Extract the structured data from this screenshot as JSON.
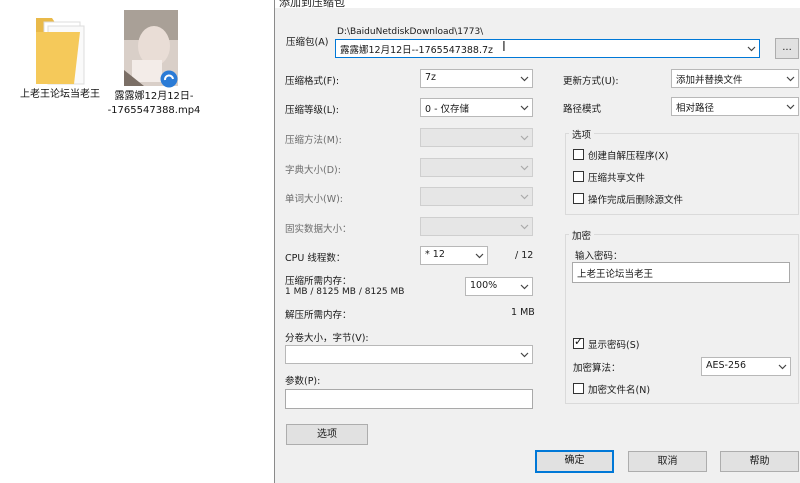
{
  "desktop": {
    "folder": {
      "label": "上老王论坛当老王"
    },
    "video": {
      "label": "露露娜12月12日--1765547388.mp4"
    }
  },
  "dialog": {
    "title": "添加到压缩包",
    "archive": {
      "label": "压缩包(A)",
      "path": "D:\\BaiduNetdiskDownload\\1773\\",
      "filename": "露露娜12月12日--1765547388.7z",
      "browse_label": "..."
    },
    "left": {
      "format": {
        "label": "压缩格式(F):",
        "value": "7z"
      },
      "level": {
        "label": "压缩等级(L):",
        "value": "0 - 仅存储"
      },
      "method": {
        "label": "压缩方法(M):",
        "value": ""
      },
      "dict": {
        "label": "字典大小(D):",
        "value": ""
      },
      "word": {
        "label": "单词大小(W):",
        "value": ""
      },
      "solid": {
        "label": "固实数据大小：",
        "value": ""
      },
      "threads": {
        "label": "CPU 线程数：",
        "value": "* 12",
        "total": "/ 12"
      },
      "memory": {
        "label": "压缩所需内存：",
        "detail": "1 MB / 8125 MB / 8125 MB",
        "percent": "100%"
      },
      "decompress": {
        "label": "解压所需内存：",
        "value": "1 MB"
      },
      "volume": {
        "label": "分卷大小，字节(V):",
        "value": ""
      },
      "params": {
        "label": "参数(P):",
        "value": ""
      },
      "options_button": "选项"
    },
    "right": {
      "update": {
        "label": "更新方式(U):",
        "value": "添加并替换文件"
      },
      "pathmode": {
        "label": "路径模式",
        "value": "相对路径"
      },
      "options_group": {
        "title": "选项",
        "sfx": {
          "label": "创建自解压程序(X)",
          "checked": false
        },
        "shared": {
          "label": "压缩共享文件",
          "checked": false
        },
        "delete": {
          "label": "操作完成后删除源文件",
          "checked": false
        }
      },
      "encryption": {
        "title": "加密",
        "password_label": "输入密码：",
        "password": "上老王论坛当老王",
        "show_password": {
          "label": "显示密码(S)",
          "checked": true
        },
        "method_label": "加密算法：",
        "method": "AES-256",
        "encrypt_names": {
          "label": "加密文件名(N)",
          "checked": false
        }
      }
    },
    "buttons": {
      "ok": "确定",
      "cancel": "取消",
      "help": "帮助"
    }
  },
  "icons": {
    "folder": "folder-icon",
    "video": "video-thumbnail-icon",
    "badge": "baidu-netdisk-badge-icon",
    "dropdown": "chevron-down-icon",
    "text_cursor": "text-cursor-icon"
  },
  "colors": {
    "dialog_bg": "#f0f0f0",
    "default_button_border": "#0078d7",
    "folder": "#f5c95a",
    "badge": "#2b7bd6"
  }
}
